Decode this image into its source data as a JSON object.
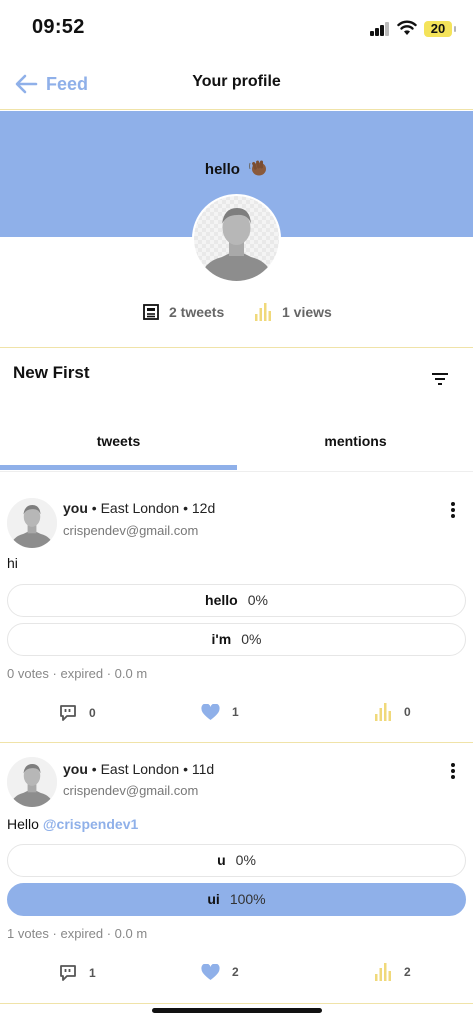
{
  "status_bar": {
    "time": "09:52",
    "battery": "20"
  },
  "nav": {
    "back_label": "Feed",
    "title": "Your profile"
  },
  "profile": {
    "greeting": "hello",
    "tweets_stat": "2 tweets",
    "views_stat": "1 views"
  },
  "feed": {
    "sort_label": "New First",
    "tabs": [
      {
        "label": "tweets",
        "active": true
      },
      {
        "label": "mentions",
        "active": false
      }
    ]
  },
  "tweets": [
    {
      "name": "you",
      "location": "East London",
      "age": "12d",
      "email": "crispendev@gmail.com",
      "text": "hi",
      "mention": "",
      "poll_options": [
        {
          "label": "hello",
          "percent": "0%",
          "fraction": 0
        },
        {
          "label": "i'm",
          "percent": "0%",
          "fraction": 0
        }
      ],
      "poll_meta": "0 votes · expired · 0.0 m",
      "comments": "0",
      "likes": "1",
      "views": "0"
    },
    {
      "name": "you",
      "location": "East London",
      "age": "11d",
      "email": "crispendev@gmail.com",
      "text": "Hello",
      "mention": "@crispendev1",
      "poll_options": [
        {
          "label": "u",
          "percent": "0%",
          "fraction": 0
        },
        {
          "label": "ui",
          "percent": "100%",
          "fraction": 1
        }
      ],
      "poll_meta": "1 votes · expired · 0.0 m",
      "comments": "1",
      "likes": "2",
      "views": "2"
    }
  ],
  "colors": {
    "accent_blue": "#8fb0e9",
    "accent_gold": "#f0d97a",
    "divider_gold": "#f0e3a8"
  },
  "icons": [
    "back-arrow-icon",
    "waving-hand-icon",
    "document-icon",
    "bar-chart-icon",
    "filter-icon",
    "more-vertical-icon",
    "comment-icon",
    "heart-icon"
  ]
}
